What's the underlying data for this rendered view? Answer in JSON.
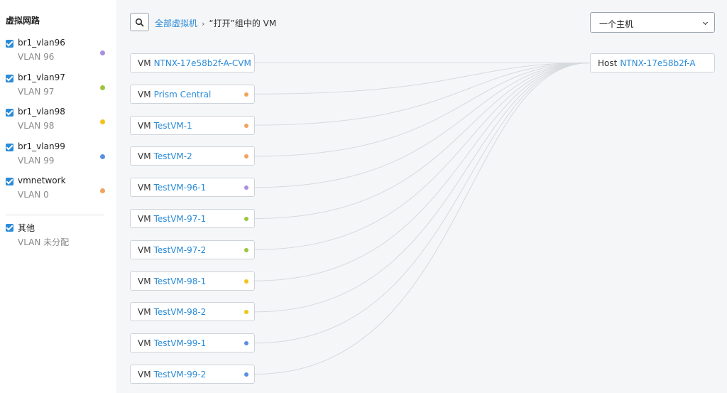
{
  "sidebar": {
    "title": "虚拟网路",
    "networks": [
      {
        "name": "br1_vlan96",
        "vlan": "VLAN 96",
        "color": "#a98fe0"
      },
      {
        "name": "br1_vlan97",
        "vlan": "VLAN 97",
        "color": "#9dc43d"
      },
      {
        "name": "br1_vlan98",
        "vlan": "VLAN 98",
        "color": "#f0c419"
      },
      {
        "name": "br1_vlan99",
        "vlan": "VLAN 99",
        "color": "#5b8fe0"
      },
      {
        "name": "vmnetwork",
        "vlan": "VLAN 0",
        "color": "#f0a35e"
      }
    ],
    "other": {
      "name": "其他",
      "vlan": "VLAN 未分配"
    }
  },
  "breadcrumb": {
    "root": "全部虚拟机",
    "separator": "›",
    "current": "“打开”组中的 VM"
  },
  "host_select": {
    "value": "一个主机"
  },
  "vms": [
    {
      "prefix": "VM",
      "name": "NTNX-17e58b2f-A-CVM",
      "color": ""
    },
    {
      "prefix": "VM",
      "name": "Prism Central",
      "color": "#f0a35e"
    },
    {
      "prefix": "VM",
      "name": "TestVM-1",
      "color": "#f0a35e"
    },
    {
      "prefix": "VM",
      "name": "TestVM-2",
      "color": "#f0a35e"
    },
    {
      "prefix": "VM",
      "name": "TestVM-96-1",
      "color": "#a98fe0"
    },
    {
      "prefix": "VM",
      "name": "TestVM-97-1",
      "color": "#9dc43d"
    },
    {
      "prefix": "VM",
      "name": "TestVM-97-2",
      "color": "#9dc43d"
    },
    {
      "prefix": "VM",
      "name": "TestVM-98-1",
      "color": "#f0c419"
    },
    {
      "prefix": "VM",
      "name": "TestVM-98-2",
      "color": "#f0c419"
    },
    {
      "prefix": "VM",
      "name": "TestVM-99-1",
      "color": "#5b8fe0"
    },
    {
      "prefix": "VM",
      "name": "TestVM-99-2",
      "color": "#5b8fe0"
    }
  ],
  "host": {
    "prefix": "Host",
    "name": "NTNX-17e58b2f-A"
  },
  "icons": {
    "search": "search-icon",
    "dropdown": "chevron-down-icon",
    "checkbox": "checkbox-checked-icon"
  }
}
